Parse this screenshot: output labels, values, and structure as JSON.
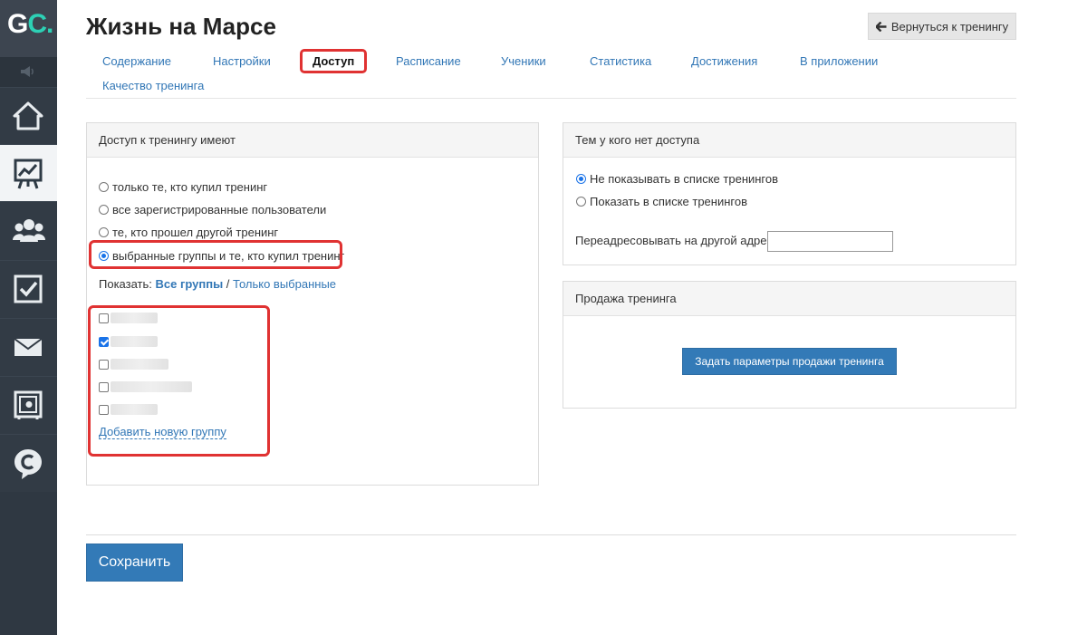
{
  "app": {
    "logo_text_g": "G",
    "logo_text_c": "C",
    "logo_dot": "."
  },
  "sidebar": {
    "items": [
      {
        "icon": "home-icon",
        "label": ""
      },
      {
        "icon": "training-chart-icon",
        "active": true
      },
      {
        "icon": "users-icon"
      },
      {
        "icon": "tasks-checkbox-icon"
      },
      {
        "icon": "mail-icon"
      },
      {
        "icon": "safe-icon"
      },
      {
        "icon": "chat-c-icon"
      }
    ]
  },
  "header": {
    "title": "Жизнь на Марсе",
    "back_label": "Вернуться к тренингу"
  },
  "tabs": [
    {
      "label": "Содержание"
    },
    {
      "label": "Настройки"
    },
    {
      "label": "Доступ",
      "active": true
    },
    {
      "label": "Расписание"
    },
    {
      "label": "Ученики"
    },
    {
      "label": "Статистика"
    },
    {
      "label": "Достижения"
    },
    {
      "label": "В приложении"
    },
    {
      "label": "Качество тренинга"
    }
  ],
  "access_panel": {
    "title": "Доступ к тренингу имеют",
    "options": [
      {
        "label": "только те, кто купил тренинг",
        "selected": false
      },
      {
        "label": "все зарегистрированные пользователи",
        "selected": false
      },
      {
        "label": "те, кто прошел другой тренинг",
        "selected": false
      },
      {
        "label": "выбранные группы и те, кто купил тренинг",
        "selected": true
      }
    ],
    "show_label": "Показать:",
    "show_all": "Все группы",
    "show_sep": " / ",
    "show_selected": "Только выбранные",
    "groups": [
      {
        "checked": false
      },
      {
        "checked": true
      },
      {
        "checked": false
      },
      {
        "checked": false
      },
      {
        "checked": false
      }
    ],
    "add_group": "Добавить новую группу"
  },
  "no_access_panel": {
    "title": "Тем у кого нет доступа",
    "options": [
      {
        "label": "Не показывать в списке тренингов",
        "selected": true
      },
      {
        "label": "Показать в списке тренингов",
        "selected": false
      }
    ],
    "redirect_label": "Переадресовывать на другой адрес",
    "redirect_value": ""
  },
  "sale_panel": {
    "title": "Продажа тренинга",
    "button_label": "Задать параметры продажи тренинга"
  },
  "footer": {
    "save_label": "Сохранить"
  },
  "colors": {
    "accent": "#337ab7",
    "highlight": "#e03232",
    "sidebar": "#323b45",
    "logo_accent": "#2dd0b5"
  }
}
